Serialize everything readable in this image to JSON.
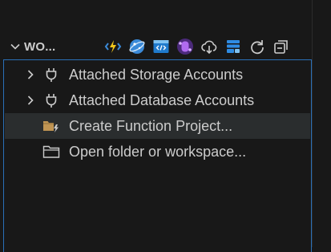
{
  "section": {
    "title": "WO...",
    "collapse_icon": "chevron-down-icon",
    "actions": [
      {
        "name": "azure-functions-icon"
      },
      {
        "name": "cosmos-db-icon"
      },
      {
        "name": "app-service-icon"
      },
      {
        "name": "logic-apps-icon"
      },
      {
        "name": "deploy-cloud-icon"
      },
      {
        "name": "storage-icon"
      },
      {
        "name": "refresh-icon"
      },
      {
        "name": "collapse-all-icon"
      }
    ]
  },
  "tree": {
    "items": [
      {
        "label": "Attached Storage Accounts",
        "icon": "plug-icon",
        "expandable": true
      },
      {
        "label": "Attached Database Accounts",
        "icon": "plug-icon",
        "expandable": true
      },
      {
        "label": "Create Function Project...",
        "icon": "new-function-folder-icon",
        "expandable": false
      },
      {
        "label": "Open folder or workspace...",
        "icon": "folder-icon",
        "expandable": false
      }
    ]
  },
  "colors": {
    "background": "#181818",
    "focus_border": "#2a70b8",
    "hover_row": "#2a2d2e",
    "text": "#cccccc",
    "functions_accent": "#f1c61a",
    "cosmos_accent": "#3b8ad8",
    "app_service_accent": "#1f7acc",
    "logic_apps_accent": "#9b4fd1"
  }
}
